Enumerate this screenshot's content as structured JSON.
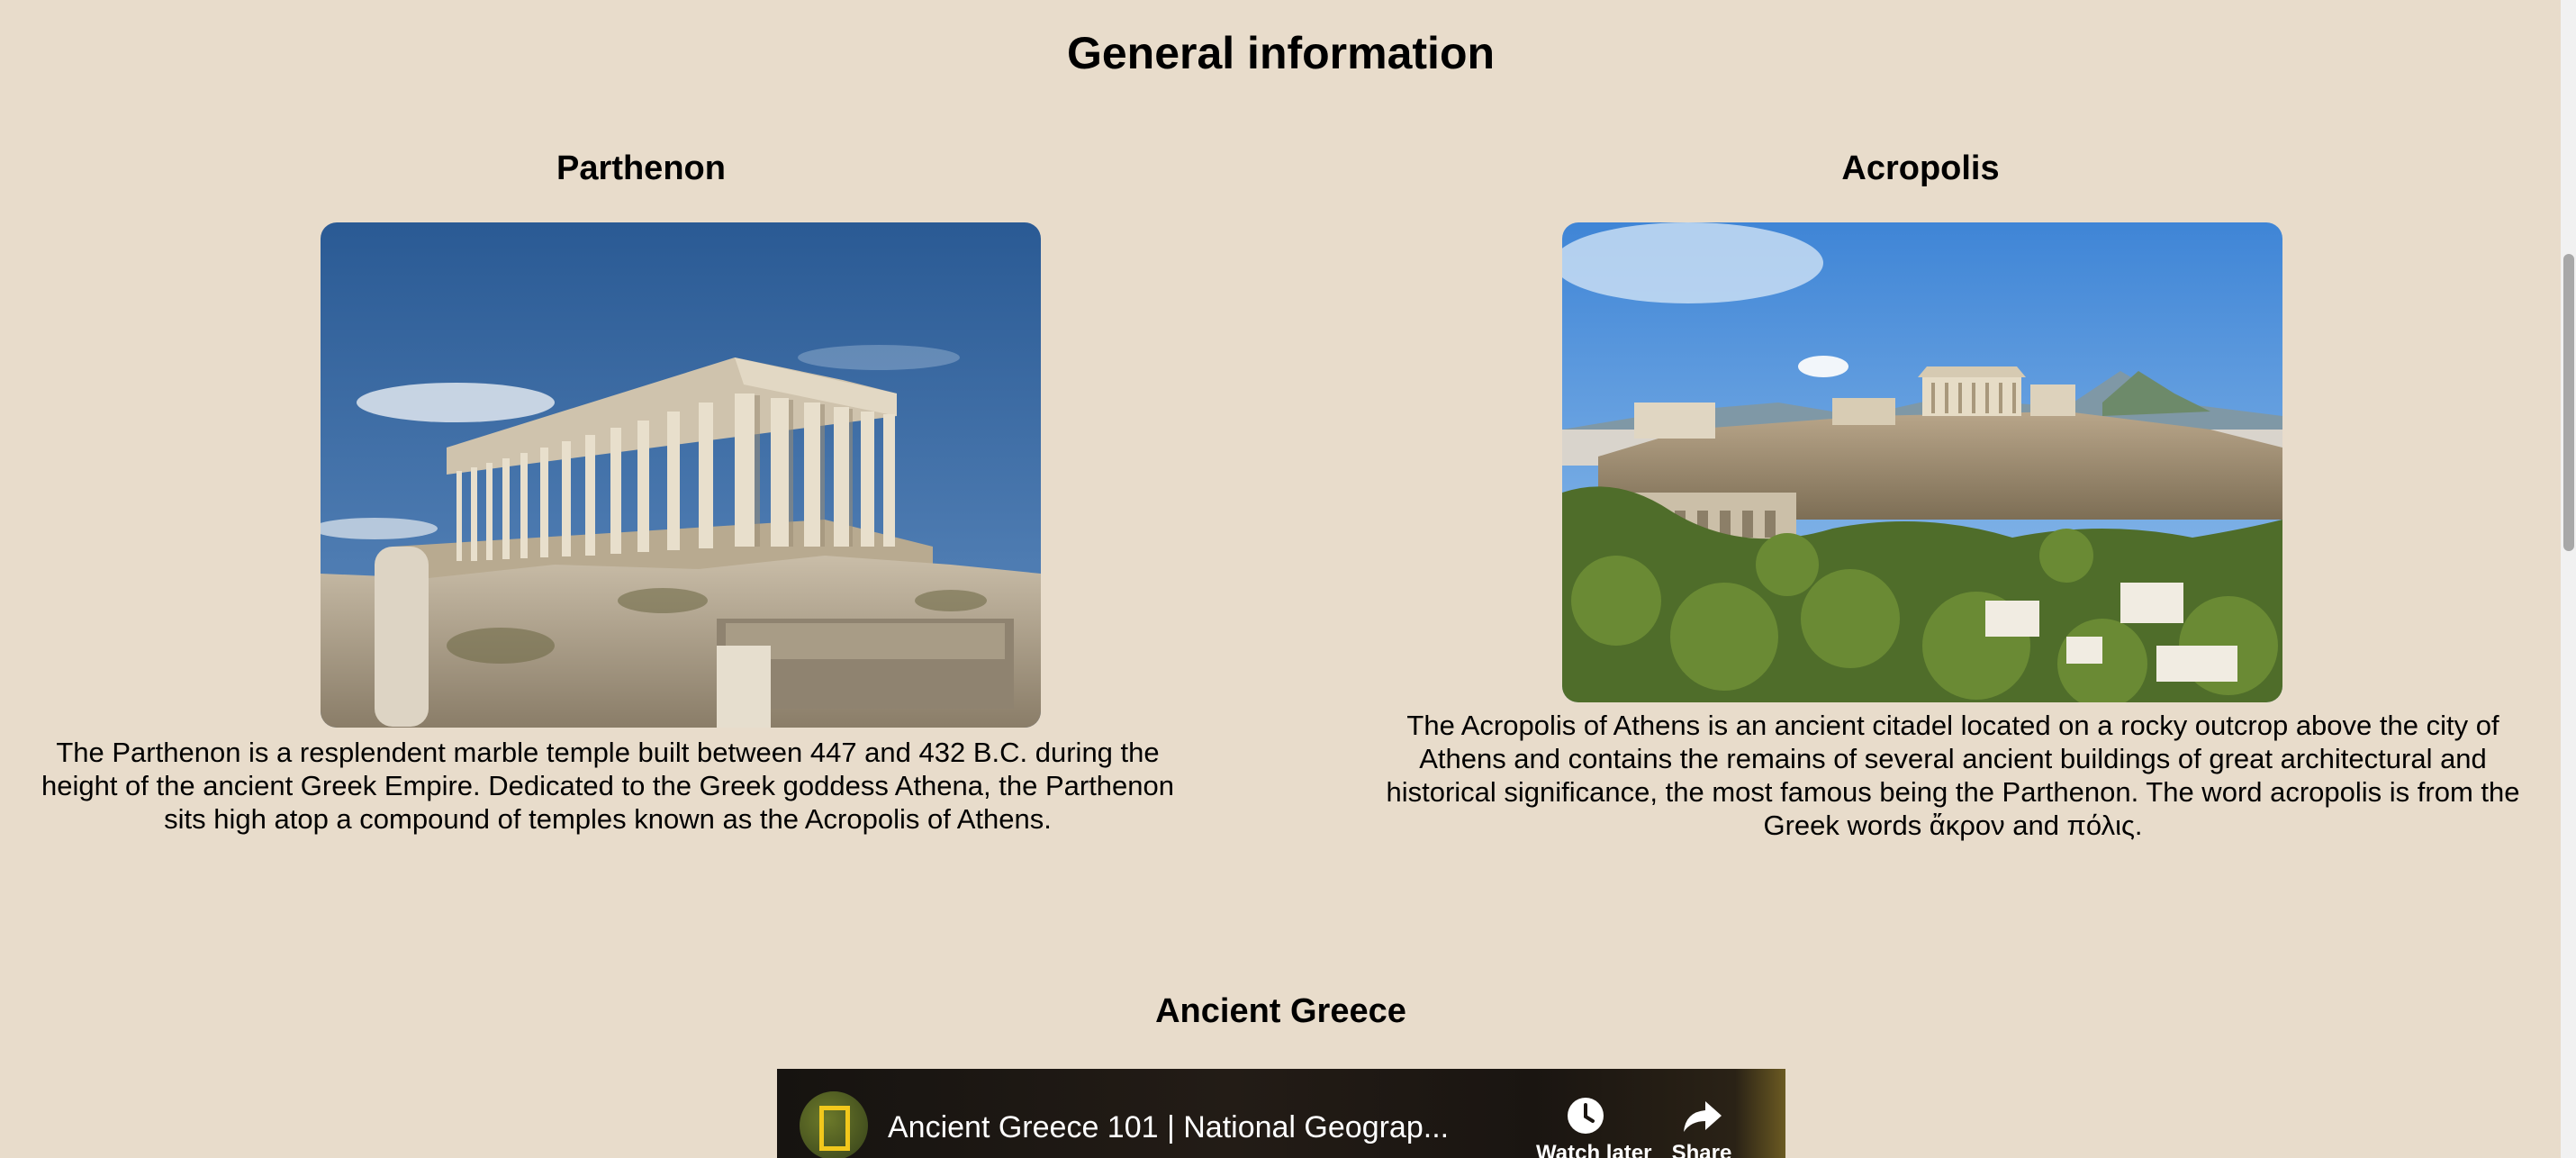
{
  "page": {
    "title": "General information"
  },
  "parthenon": {
    "heading": "Parthenon",
    "image_alt": "Parthenon temple photo",
    "description": "The Parthenon is a resplendent marble temple built between 447 and 432 B.C. during the height of the ancient Greek Empire. Dedicated to the Greek goddess Athena, the Parthenon sits high atop a compound of temples known as the Acropolis of Athens."
  },
  "acropolis": {
    "heading": "Acropolis",
    "image_alt": "Acropolis of Athens photo",
    "description": "The Acropolis of Athens is an ancient citadel located on a rocky outcrop above the city of Athens and contains the remains of several ancient buildings of great architectural and historical significance, the most famous being the Parthenon. The word acropolis is from the Greek words ἄκρον and πόλις."
  },
  "ancient_greece": {
    "heading": "Ancient Greece",
    "video": {
      "title": "Ancient Greece 101 | National Geograp...",
      "watch_later_label": "Watch later",
      "share_label": "Share",
      "watch_later_icon": "clock-icon",
      "share_icon": "share-arrow-icon",
      "channel_icon": "national-geographic-logo"
    }
  },
  "colors": {
    "background": "#e8dccb",
    "text": "#000000",
    "natgeo_yellow": "#f2c81c"
  }
}
